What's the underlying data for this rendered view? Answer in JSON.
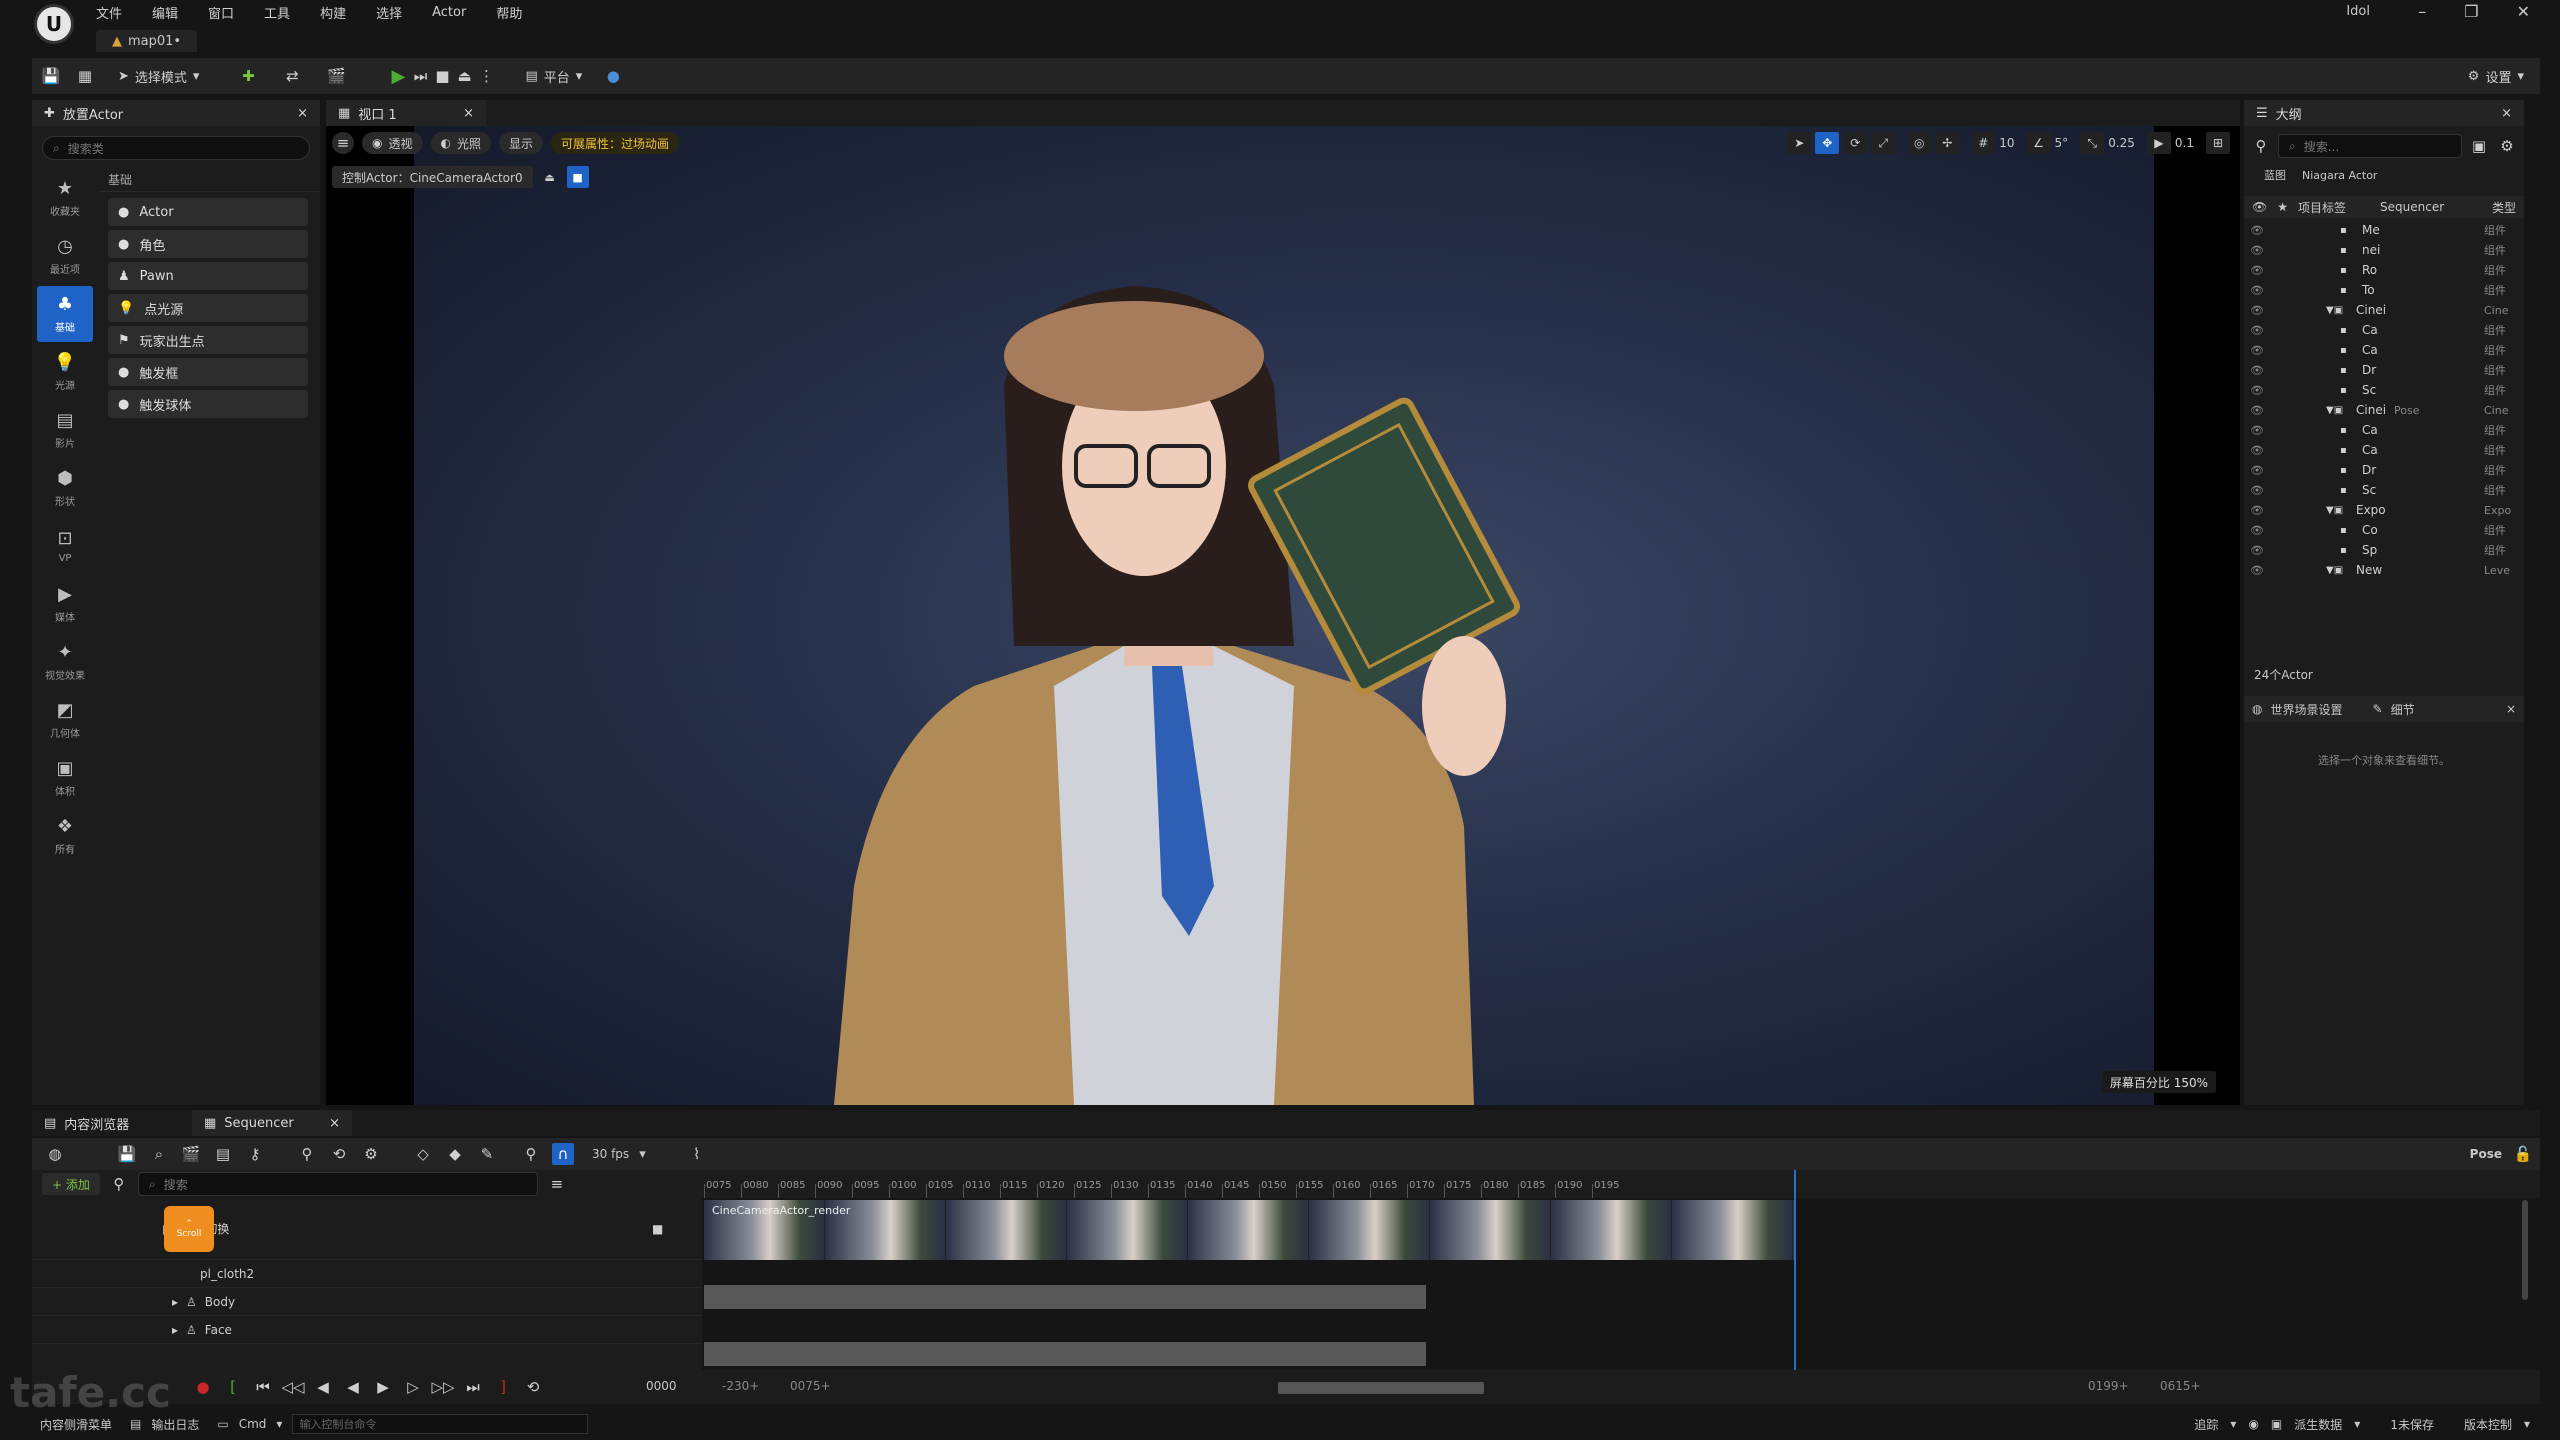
{
  "app": {
    "title": "Idol",
    "document_tab": "map01•"
  },
  "menu": [
    "文件",
    "编辑",
    "窗口",
    "工具",
    "构建",
    "选择",
    "Actor",
    "帮助"
  ],
  "window_controls": [
    "–",
    "❐",
    "✕"
  ],
  "toolbar": {
    "select_mode": "选择模式",
    "platform": "平台",
    "settings": "设置"
  },
  "left_panel": {
    "tab": "放置Actor",
    "search_placeholder": "搜索类",
    "categories": [
      {
        "label": "收藏夹",
        "icon": "star-icon"
      },
      {
        "label": "最近项",
        "icon": "clock-icon"
      },
      {
        "label": "基础",
        "icon": "basic-icon",
        "active": true
      },
      {
        "label": "光源",
        "icon": "light-icon"
      },
      {
        "label": "影片",
        "icon": "film-icon"
      },
      {
        "label": "形状",
        "icon": "shape-icon"
      },
      {
        "label": "VP",
        "icon": "vp-icon"
      },
      {
        "label": "媒体",
        "icon": "media-icon"
      },
      {
        "label": "视觉效果",
        "icon": "vfx-icon"
      },
      {
        "label": "几何体",
        "icon": "geometry-icon"
      },
      {
        "label": "体积",
        "icon": "volume-icon"
      },
      {
        "label": "所有",
        "icon": "all-icon"
      }
    ],
    "list_header": "基础",
    "actors": [
      "Actor",
      "角色",
      "Pawn",
      "点光源",
      "玩家出生点",
      "触发框",
      "触发球体"
    ]
  },
  "viewport": {
    "tab": "视口 1",
    "pills": [
      "透视",
      "光照",
      "显示"
    ],
    "warning": "可展属性：过场动画",
    "pilot": "控制Actor：CineCameraActor0",
    "grid": "10",
    "angle": "5°",
    "scale": "0.25",
    "cam_speed": "0.1",
    "screen_pct": "屏幕百分比 150%"
  },
  "outliner": {
    "tab": "大纲",
    "search_placeholder": "搜索...",
    "subtabs": [
      "蓝图",
      "Niagara Actor"
    ],
    "columns": {
      "label": "项目标签",
      "sequencer": "Sequencer",
      "type": "类型"
    },
    "rows": [
      {
        "label": "Me",
        "type": "组件"
      },
      {
        "label": "nei",
        "type": "组件"
      },
      {
        "label": "Ro",
        "type": "组件"
      },
      {
        "label": "To",
        "type": "组件"
      },
      {
        "label": "Cinei",
        "type": "Cine"
      },
      {
        "label": "Ca",
        "type": "组件"
      },
      {
        "label": "Ca",
        "type": "组件"
      },
      {
        "label": "Dr",
        "type": "组件"
      },
      {
        "label": "Sc",
        "type": "组件"
      },
      {
        "label": "Cinei",
        "sequencer": "Pose",
        "type": "Cine"
      },
      {
        "label": "Ca",
        "type": "组件"
      },
      {
        "label": "Ca",
        "type": "组件"
      },
      {
        "label": "Dr",
        "type": "组件"
      },
      {
        "label": "Sc",
        "type": "组件"
      },
      {
        "label": "Expo",
        "type": "Expo"
      },
      {
        "label": "Co",
        "type": "组件"
      },
      {
        "label": "Sp",
        "type": "组件"
      },
      {
        "label": "New",
        "type": "Leve"
      }
    ],
    "count": "24个Actor"
  },
  "details": {
    "tab1": "世界场景设置",
    "tab2": "细节",
    "hint": "选择一个对象来查看细节。"
  },
  "bottom_tabs": [
    "内容浏览器",
    "Sequencer"
  ],
  "sequencer": {
    "fps": "30 fps",
    "pose": "Pose",
    "add": "+ 添加",
    "search_placeholder": "搜索",
    "ticks": [
      "0075",
      "0080",
      "0085",
      "0090",
      "0095",
      "0100",
      "0105",
      "0110",
      "0115",
      "0120",
      "0125",
      "0130",
      "0135",
      "0140",
      "0145",
      "0150",
      "0155",
      "0160",
      "0165",
      "0170",
      "0175",
      "0180",
      "0185",
      "0190",
      "0195"
    ],
    "tracks": [
      {
        "label": "相机切换"
      },
      {
        "label": "pl_cloth2"
      },
      {
        "label": "Body"
      },
      {
        "label": "Face"
      }
    ],
    "clip_label": "CineCameraActor_render",
    "scroll_badge": "Scroll",
    "current_frame": "0000",
    "range_start": "-230+",
    "range_start2": "0075+",
    "range_end": "0199+",
    "range_end2": "0615+"
  },
  "status": {
    "content_drawer": "内容侧滑菜单",
    "output_log": "输出日志",
    "cmd": "Cmd",
    "console_placeholder": "输入控制台命令",
    "trace": "追踪",
    "derived": "派生数据",
    "unsaved": "1未保存",
    "source": "版本控制"
  },
  "watermark": "tafe.cc",
  "colors": {
    "accent": "#1f63c6",
    "warning": "#f0c13c",
    "play": "#4caf33",
    "record": "#c62828"
  }
}
